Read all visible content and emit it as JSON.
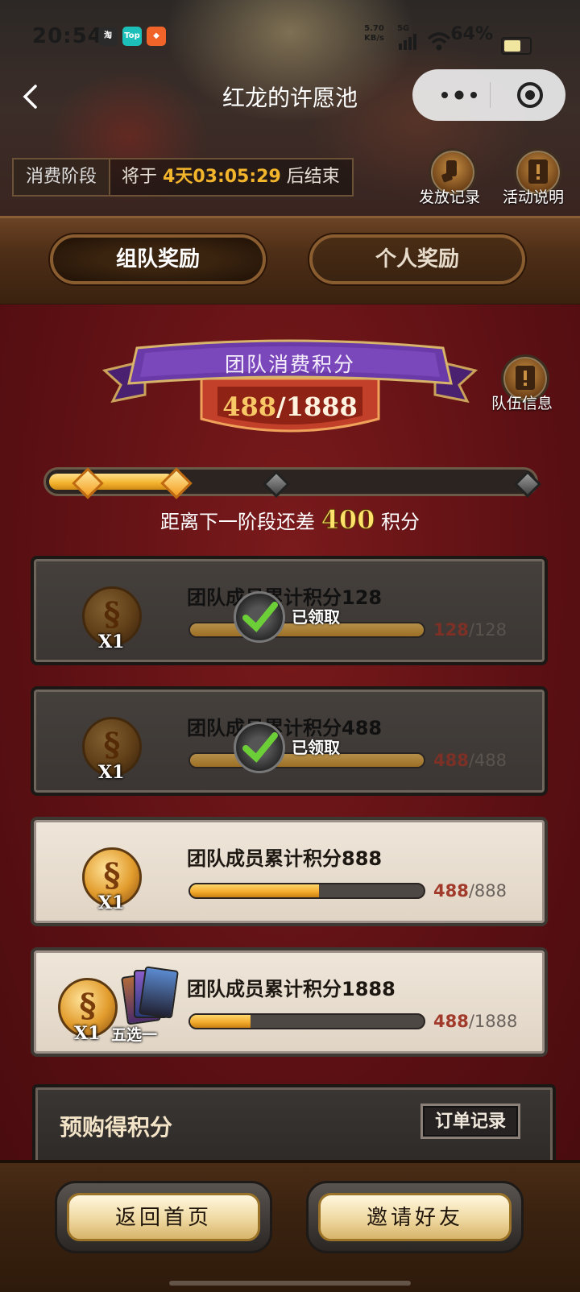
{
  "status_bar": {
    "time": "20:54",
    "net_speed_value": "5.70",
    "net_speed_unit": "KB/s",
    "network": "5G",
    "battery": "64%"
  },
  "nav": {
    "title": "红龙的许愿池"
  },
  "phase": {
    "tag": "消费阶段",
    "prefix": "将于",
    "countdown": "4天03:05:29",
    "suffix": "后结束"
  },
  "header_actions": {
    "records": "发放记录",
    "rules": "活动说明"
  },
  "tabs": [
    {
      "label": "组队奖励",
      "active": true
    },
    {
      "label": "个人奖励",
      "active": false
    }
  ],
  "team_score": {
    "title": "团队消费积分",
    "current": "488",
    "separator": "/",
    "total": "1888",
    "team_info": "队伍信息",
    "progress_fraction": 0.26,
    "gap_prefix": "距离下一阶段还差",
    "gap_value": "400",
    "gap_suffix": "积分"
  },
  "rewards": [
    {
      "title": "团队成员累计积分128",
      "qty": "X1",
      "current": "128",
      "total": "128",
      "claimed": true,
      "claimed_label": "已领取",
      "fraction": 1.0
    },
    {
      "title": "团队成员累计积分488",
      "qty": "X1",
      "current": "488",
      "total": "488",
      "claimed": true,
      "claimed_label": "已领取",
      "fraction": 1.0
    },
    {
      "title": "团队成员累计积分888",
      "qty": "X1",
      "current": "488",
      "total": "888",
      "claimed": false,
      "fraction": 0.55
    },
    {
      "title": "团队成员累计积分1888",
      "qty": "X1",
      "extra": "五选一",
      "current": "488",
      "total": "1888",
      "claimed": false,
      "fraction": 0.26
    }
  ],
  "preorder": {
    "title": "预购得积分",
    "order_button": "订单记录"
  },
  "footer": {
    "home": "返回首页",
    "invite": "邀请好友"
  },
  "colors": {
    "accent_gold": "#f3b52c",
    "main_red": "#5c1013",
    "banner_purple": "#6a3aa8"
  }
}
